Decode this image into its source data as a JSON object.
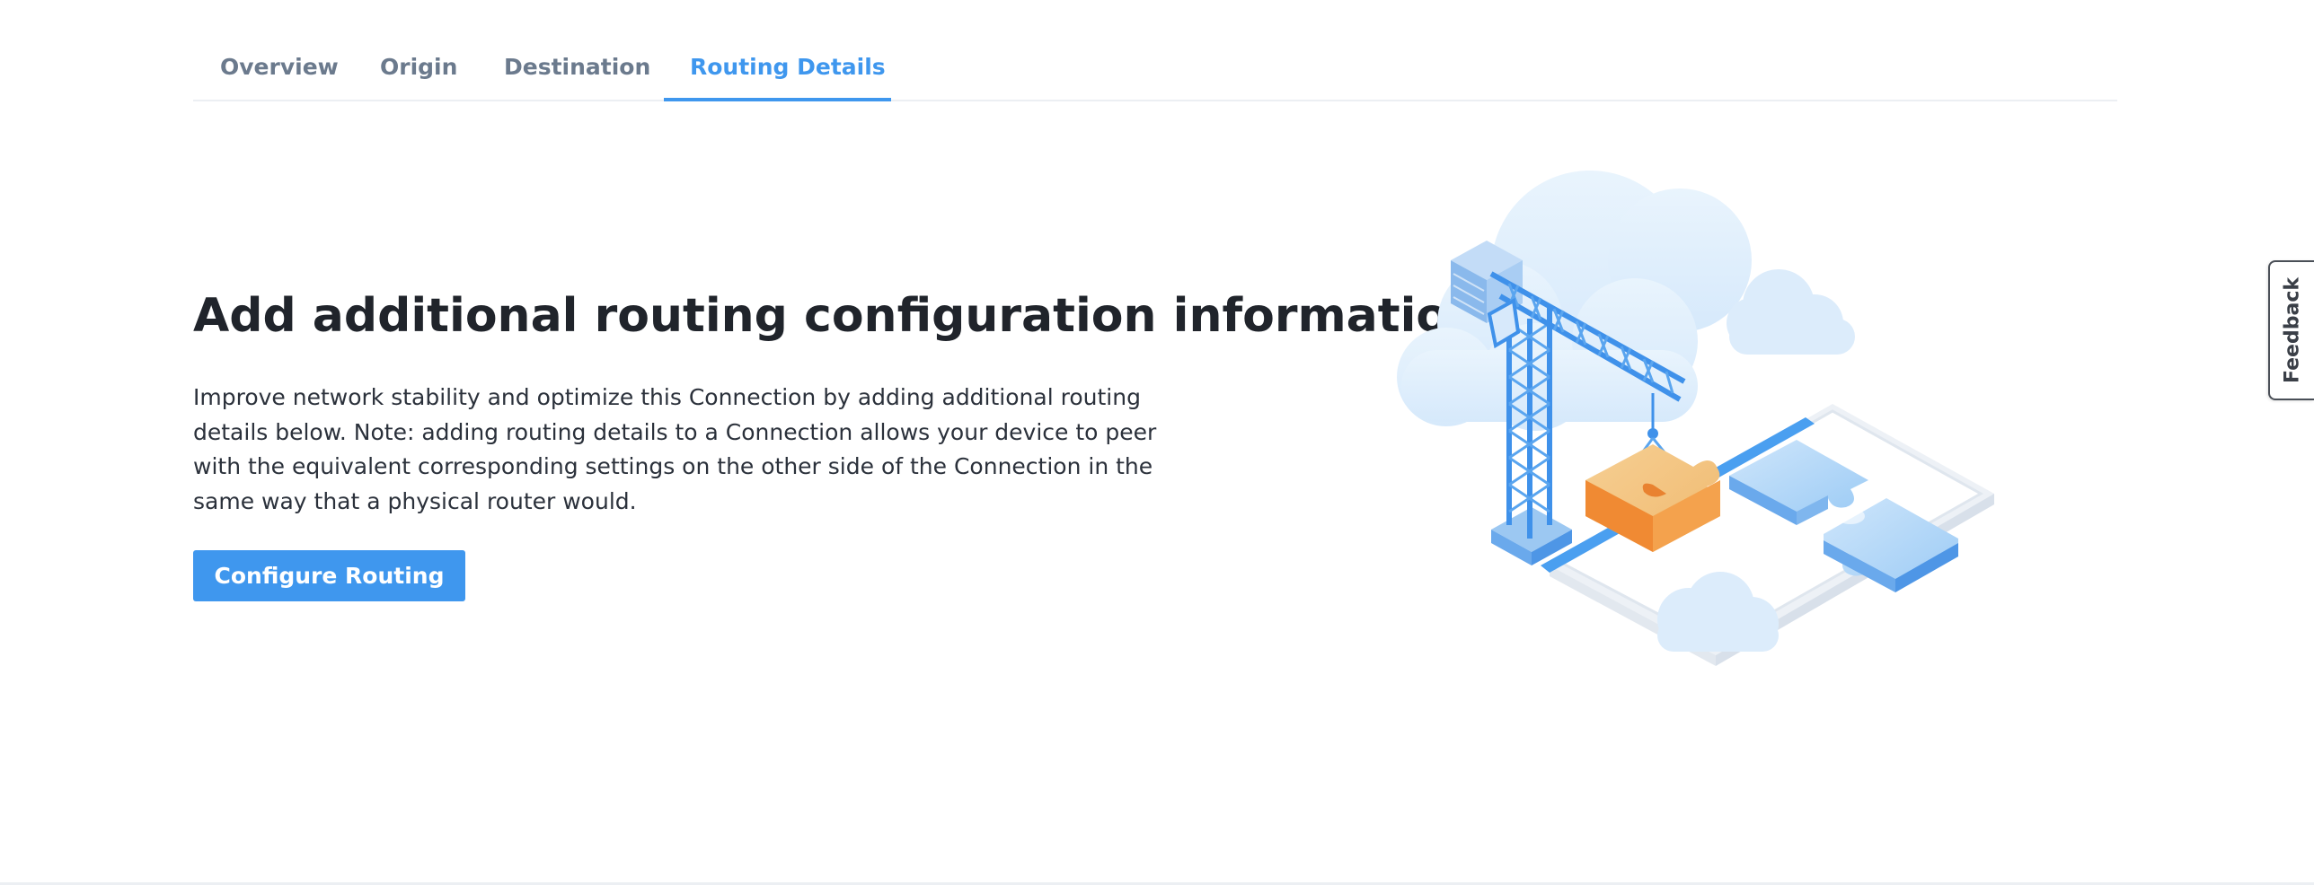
{
  "tabs": [
    {
      "label": "Overview"
    },
    {
      "label": "Origin"
    },
    {
      "label": "Destination"
    },
    {
      "label": "Routing Details",
      "active": true
    }
  ],
  "main": {
    "title": "Add additional routing configuration information",
    "description": "Improve network stability and optimize this Connection by adding additional routing details below. Note: adding routing details to a Connection allows your device to peer with the equivalent corresponding settings on the other side of the Connection in the same way that a physical router would.",
    "button_label": "Configure Routing"
  },
  "feedback": {
    "label": "Feedback"
  },
  "colors": {
    "accent": "#3f97ee",
    "tab_inactive": "#6b7a8d",
    "heading": "#20242b",
    "puzzle_orange": "#f0a050",
    "puzzle_blue": "#8fc4f3"
  },
  "illustration": {
    "icon": "crane-puzzle-illustration"
  }
}
